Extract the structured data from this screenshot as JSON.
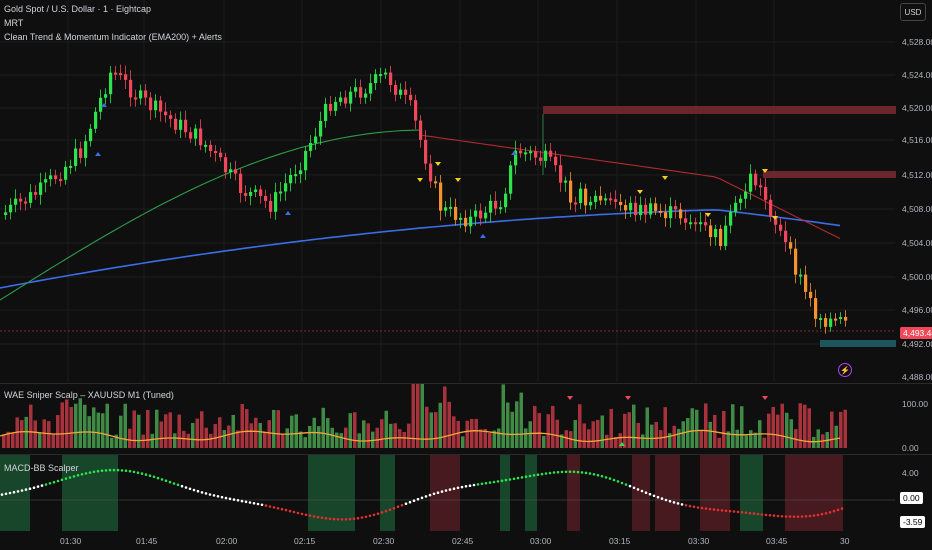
{
  "header": {
    "symbol_title": "Gold Spot / U.S. Dollar · 1 · Eightcap",
    "indicator_1": "MRT",
    "indicator_2": "Clean Trend & Momentum Indicator (EMA200) + Alerts"
  },
  "currency_button": "USD",
  "price_axis": {
    "labels": [
      "4,528.00",
      "4,524.00",
      "4,520.00",
      "4,516.00",
      "4,512.00",
      "4,508.00",
      "4,504.00",
      "4,500.00",
      "4,496.00",
      "4,492.00",
      "4,488.00"
    ],
    "current_price": "4,493.45"
  },
  "wae_pane": {
    "title": "WAE Sniper Scalp – XAUUSD M1 (Tuned)",
    "labels": [
      "100.00",
      "0.00"
    ]
  },
  "macd_pane": {
    "title": "MACD-BB Scalper",
    "labels": [
      "4.00",
      "0.00",
      "-3.59"
    ]
  },
  "time_axis": {
    "labels": [
      "01:30",
      "01:45",
      "02:00",
      "02:15",
      "02:30",
      "02:45",
      "03:00",
      "03:15",
      "03:30",
      "03:45",
      "30"
    ]
  },
  "colors": {
    "bull": "#2ee24b",
    "bear": "#f0485a",
    "orange": "#f5912e",
    "ema200": "#3a6de8",
    "ema_green": "#2d9c4b",
    "ema_red": "#b02a32"
  },
  "icons": {
    "alert": "lightning-icon"
  }
}
